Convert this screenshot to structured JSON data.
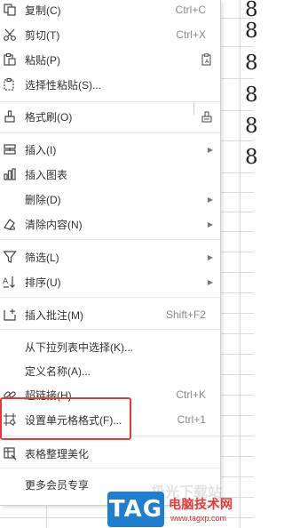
{
  "menu": {
    "items": [
      {
        "label": "复制(C)",
        "shortcut": "Ctrl+C",
        "icon": "copy-icon"
      },
      {
        "label": "剪切(T)",
        "shortcut": "Ctrl+X",
        "icon": "scissors-icon"
      },
      {
        "label": "粘贴(P)",
        "shortcut": "",
        "icon": "paste-icon"
      },
      {
        "label": "选择性粘贴(S)...",
        "shortcut": "",
        "icon": "paste-special-icon"
      },
      {
        "label": "格式刷(O)",
        "shortcut": "",
        "icon": "format-brush-icon"
      },
      {
        "label": "插入(I)",
        "shortcut": "",
        "icon": "insert-icon"
      },
      {
        "label": "插入图表",
        "shortcut": "",
        "icon": "chart-icon"
      },
      {
        "label": "删除(D)",
        "shortcut": "",
        "icon": ""
      },
      {
        "label": "清除内容(N)",
        "shortcut": "",
        "icon": "eraser-icon"
      },
      {
        "label": "筛选(L)",
        "shortcut": "",
        "icon": "filter-icon"
      },
      {
        "label": "排序(U)",
        "shortcut": "",
        "icon": "sort-icon"
      },
      {
        "label": "插入批注(M)",
        "shortcut": "Shift+F2",
        "icon": "comment-icon"
      },
      {
        "label": "从下拉列表中选择(K)...",
        "shortcut": "",
        "icon": ""
      },
      {
        "label": "定义名称(A)...",
        "shortcut": "",
        "icon": ""
      },
      {
        "label": "超链接(H)",
        "shortcut": "Ctrl+K",
        "icon": "link-icon"
      },
      {
        "label": "设置单元格格式(F)...",
        "shortcut": "Ctrl+1",
        "icon": "format-cells-icon"
      },
      {
        "label": "表格整理美化",
        "shortcut": "",
        "icon": "table-beautify-icon"
      },
      {
        "label": "更多会员专享",
        "shortcut": "",
        "icon": ""
      }
    ]
  },
  "sheet": {
    "digits": [
      "8",
      "8",
      "8",
      "8",
      "8",
      "8"
    ]
  },
  "watermark": {
    "logo": "TAG",
    "faded": "极光下载站",
    "name": "电脑技术网",
    "url": "www.tagxp.com"
  },
  "colors": {
    "highlight": "#e53935",
    "logo_bg": "#1f7fcf"
  }
}
